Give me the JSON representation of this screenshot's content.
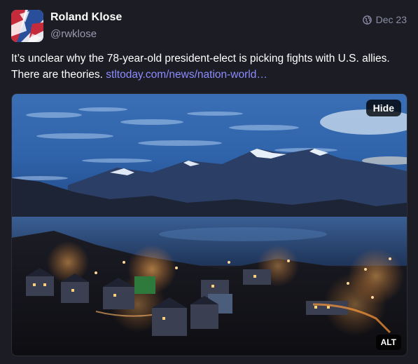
{
  "author": {
    "display_name": "Roland Klose",
    "handle": "@rwklose"
  },
  "meta": {
    "visibility_icon": "globe-icon",
    "date": "Dec 23"
  },
  "status": {
    "text": "It’s unclear why the 78-year-old president-elect is picking fights with U.S. allies. There are theories. ",
    "link_text": "stltoday.com/news/nation-world…"
  },
  "media": {
    "hide_label": "Hide",
    "alt_label": "ALT"
  },
  "colors": {
    "background": "#1c1c24",
    "link": "#8c8dff",
    "muted": "#9a9ab0"
  }
}
